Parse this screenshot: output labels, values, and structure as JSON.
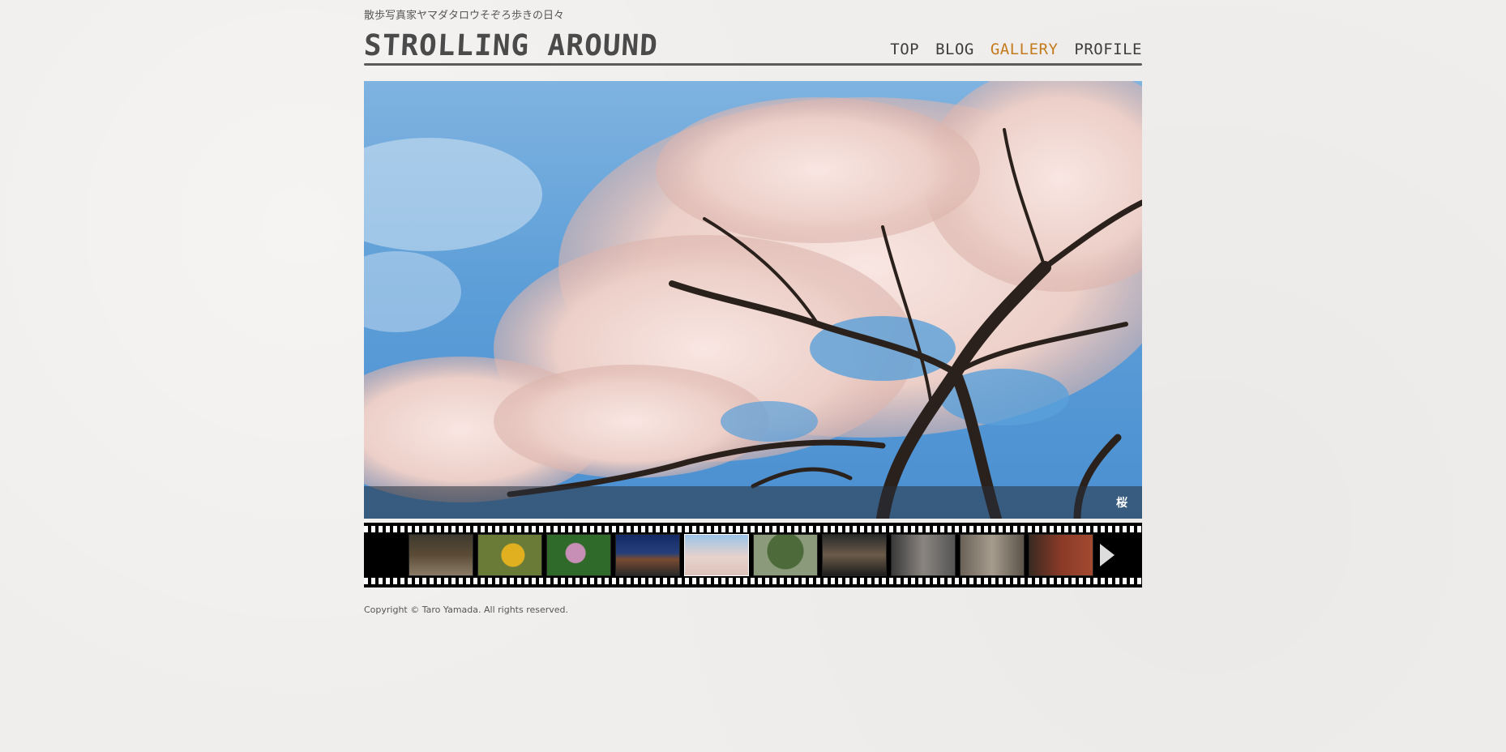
{
  "header": {
    "tagline": "散歩写真家ヤマダタロウそぞろ歩きの日々",
    "logo": "STROLLING AROUND"
  },
  "nav": {
    "items": [
      {
        "label": "TOP",
        "active": false
      },
      {
        "label": "BLOG",
        "active": false
      },
      {
        "label": "GALLERY",
        "active": true
      },
      {
        "label": "PROFILE",
        "active": false
      }
    ],
    "active_color": "#c37b1d"
  },
  "hero": {
    "caption": "桜",
    "subject": "cherry blossom tree against blue sky"
  },
  "filmstrip": {
    "thumbnails": [
      {
        "subject": "tree-lined path",
        "selected": false
      },
      {
        "subject": "sunflowers",
        "selected": false
      },
      {
        "subject": "pink flowers",
        "selected": false
      },
      {
        "subject": "brick station at night",
        "selected": false
      },
      {
        "subject": "cherry blossom",
        "selected": true
      },
      {
        "subject": "large green tree",
        "selected": false
      },
      {
        "subject": "modern building",
        "selected": false
      },
      {
        "subject": "stone building",
        "selected": false
      },
      {
        "subject": "arched building",
        "selected": false
      },
      {
        "subject": "red brick building",
        "selected": false
      }
    ],
    "next_icon": "play-arrow-icon"
  },
  "footer": {
    "copyright": "Copyright © Taro Yamada. All rights reserved."
  }
}
